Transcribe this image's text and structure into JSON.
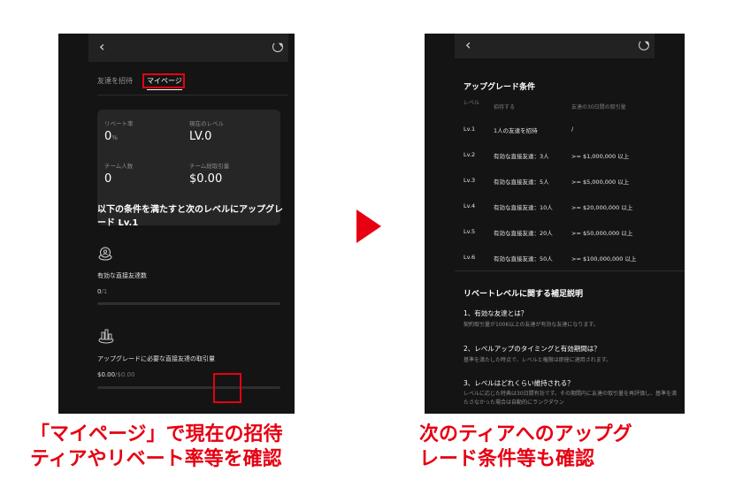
{
  "left_screen": {
    "back_glyph": "‹",
    "tabs": [
      "友達を招待",
      "マイページ"
    ],
    "stats": {
      "rebate_rate": {
        "label": "リベート率",
        "value": "0",
        "unit": "%"
      },
      "current_level": {
        "label": "現在のレベル",
        "value": "LV.0"
      },
      "team_count": {
        "label": "チーム人数",
        "value": "0"
      },
      "team_volume": {
        "label": "チーム総取引量",
        "value": "$0.00"
      }
    },
    "condition_title": "以下の条件を満たすと次のレベルにアップグレード Lv.1",
    "conditions": [
      {
        "label": "有効な直接友達数",
        "progress_current": "0",
        "progress_total": "/1",
        "fill": 0
      },
      {
        "label": "アップグレードに必要な直接友達の取引量",
        "progress_current": "$0.00",
        "progress_total": "/$0.00",
        "fill": 0
      }
    ]
  },
  "right_screen": {
    "back_glyph": "‹",
    "upgrade_title": "アップグレード条件",
    "headers": {
      "level": "レベル",
      "invite": "招待する",
      "volume": "友達の30日間の取引量"
    },
    "rows": [
      {
        "level": "Lv.1",
        "invite": "1人の友達を招待",
        "volume": "/"
      },
      {
        "level": "Lv.2",
        "invite": "有効な直接友達：3人",
        "volume": ">= $1,000,000 以上"
      },
      {
        "level": "Lv.3",
        "invite": "有効な直接友達：5人",
        "volume": ">= $5,000,000 以上"
      },
      {
        "level": "Lv.4",
        "invite": "有効な直接友達：10人",
        "volume": ">= $20,000,000 以上"
      },
      {
        "level": "Lv.5",
        "invite": "有効な直接友達：20人",
        "volume": ">= $50,000,000 以上"
      },
      {
        "level": "Lv.6",
        "invite": "有効な直接友達：50人",
        "volume": ">= $100,000,000 以上"
      }
    ],
    "faq_title": "リベートレベルに関する補足説明",
    "faq": [
      {
        "q": "1、有効な友達とは？",
        "a": "契約取引量が100K以上の友達が有効な友達になります。"
      },
      {
        "q": "2、レベルアップのタイミングと有効期間は？",
        "a": "基準を満たした時点で、レベルと権限は即座に適用されます。"
      },
      {
        "q": "3、レベルはどれくらい維持される？",
        "a": "レベルに応じた特典は30日間有効です。その期間内に友達の取引量を再評価し、基準を満たさなかった場合は自動的にランクダウン"
      }
    ]
  },
  "captions": {
    "left_line1": "「マイページ」で現在の招待",
    "left_line2": "ティアやリベート率等を確認",
    "right_line1": "次のティアへのアップグ",
    "right_line2": "レード条件等も確認"
  },
  "colors": {
    "accent": "#e60012",
    "screen_bg": "#141414",
    "card_bg": "#262626"
  }
}
